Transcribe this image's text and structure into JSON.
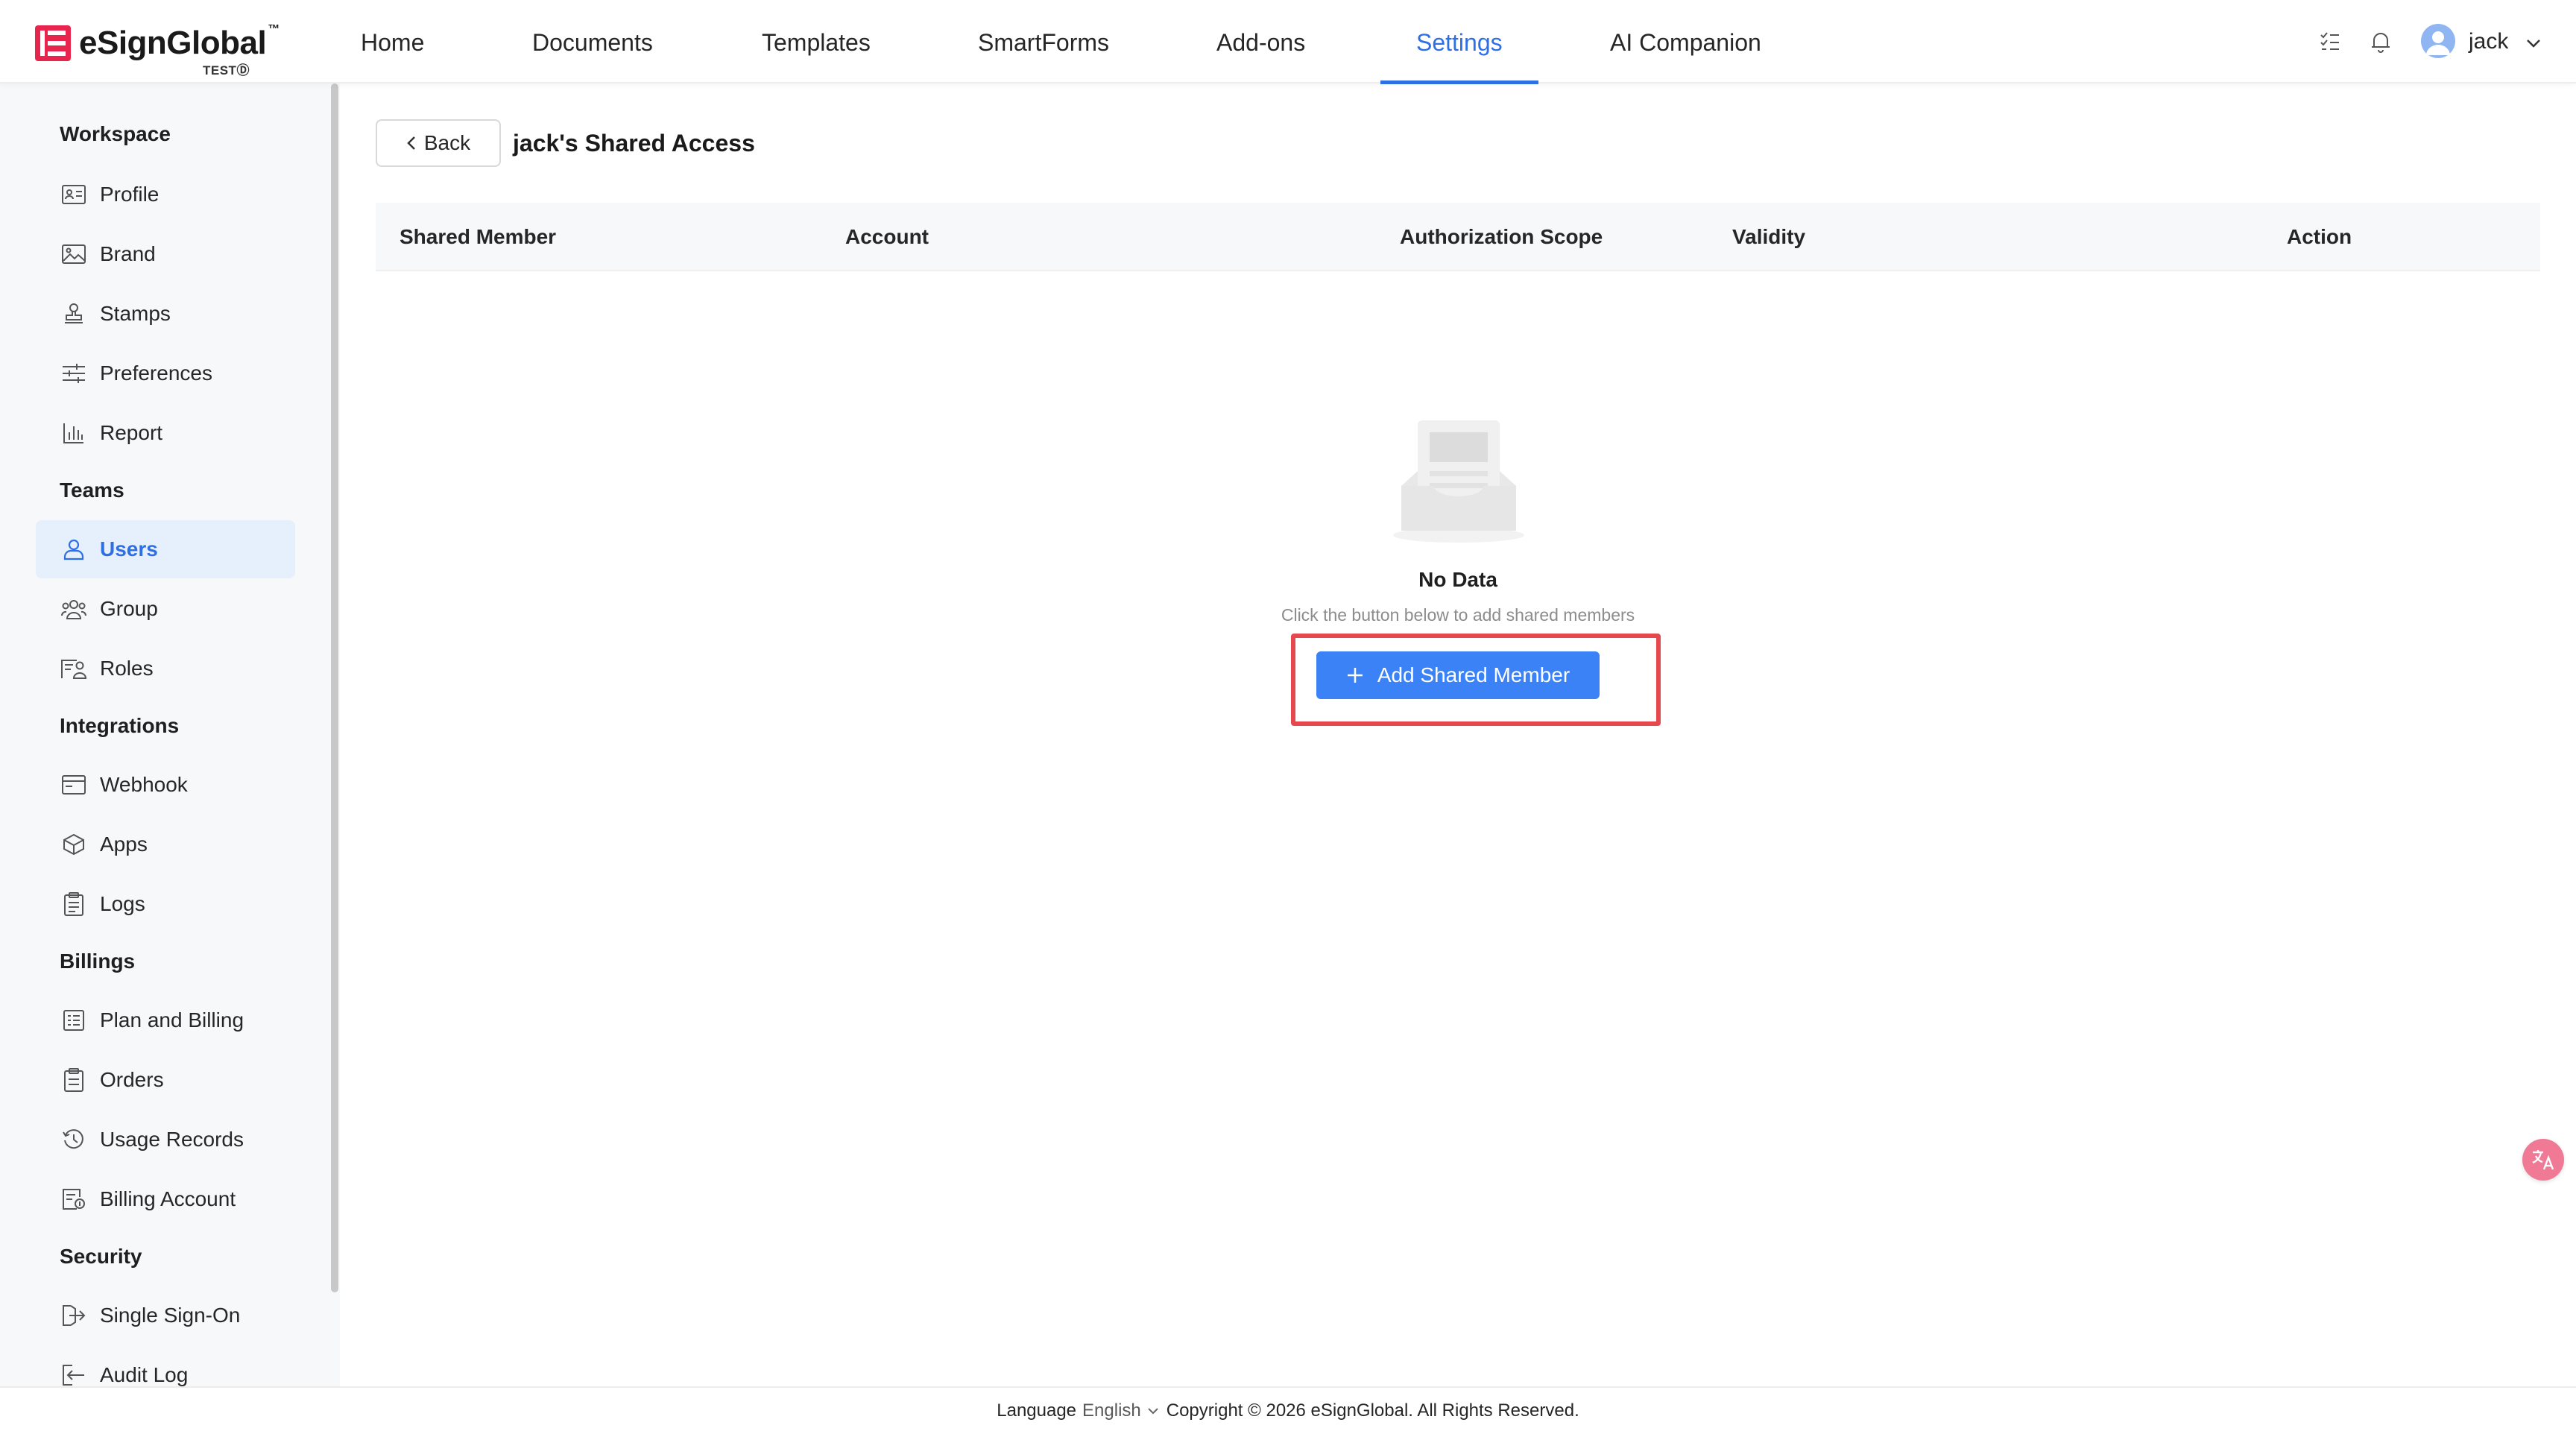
{
  "header": {
    "brand": "eSignGlobal",
    "trademark": "™",
    "environment_badge": "TEST",
    "environment_mark": "Ⓓ",
    "nav": [
      {
        "label": "Home"
      },
      {
        "label": "Documents"
      },
      {
        "label": "Templates"
      },
      {
        "label": "SmartForms"
      },
      {
        "label": "Add-ons"
      },
      {
        "label": "Settings",
        "active": true
      },
      {
        "label": "AI Companion"
      }
    ],
    "user": {
      "name": "jack"
    }
  },
  "sidebar": {
    "sections": [
      {
        "title": "Workspace",
        "items": [
          "Profile",
          "Brand",
          "Stamps",
          "Preferences",
          "Report"
        ]
      },
      {
        "title": "Teams",
        "items": [
          "Users",
          "Group",
          "Roles"
        ]
      },
      {
        "title": "Integrations",
        "items": [
          "Webhook",
          "Apps",
          "Logs"
        ]
      },
      {
        "title": "Billings",
        "items": [
          "Plan and Billing",
          "Orders",
          "Usage Records",
          "Billing Account"
        ]
      },
      {
        "title": "Security",
        "items": [
          "Single Sign-On",
          "Audit Log"
        ]
      }
    ],
    "active_item": "Users"
  },
  "main": {
    "back_label": "Back",
    "title": "jack's Shared Access",
    "table": {
      "columns": [
        "Shared Member",
        "Account",
        "Authorization Scope",
        "Validity",
        "Action"
      ],
      "rows": []
    },
    "empty": {
      "title": "No Data",
      "description": "Click the button below to add shared members",
      "button_label": "Add Shared Member"
    }
  },
  "footer": {
    "language_label": "Language",
    "language_value": "English",
    "copyright": "Copyright © 2026 eSignGlobal. All Rights Reserved."
  },
  "colors": {
    "accent": "#2f6fe4",
    "primary_button": "#3b82f6",
    "highlight": "#e5494d",
    "sidebar_active_bg": "#e6effc"
  }
}
